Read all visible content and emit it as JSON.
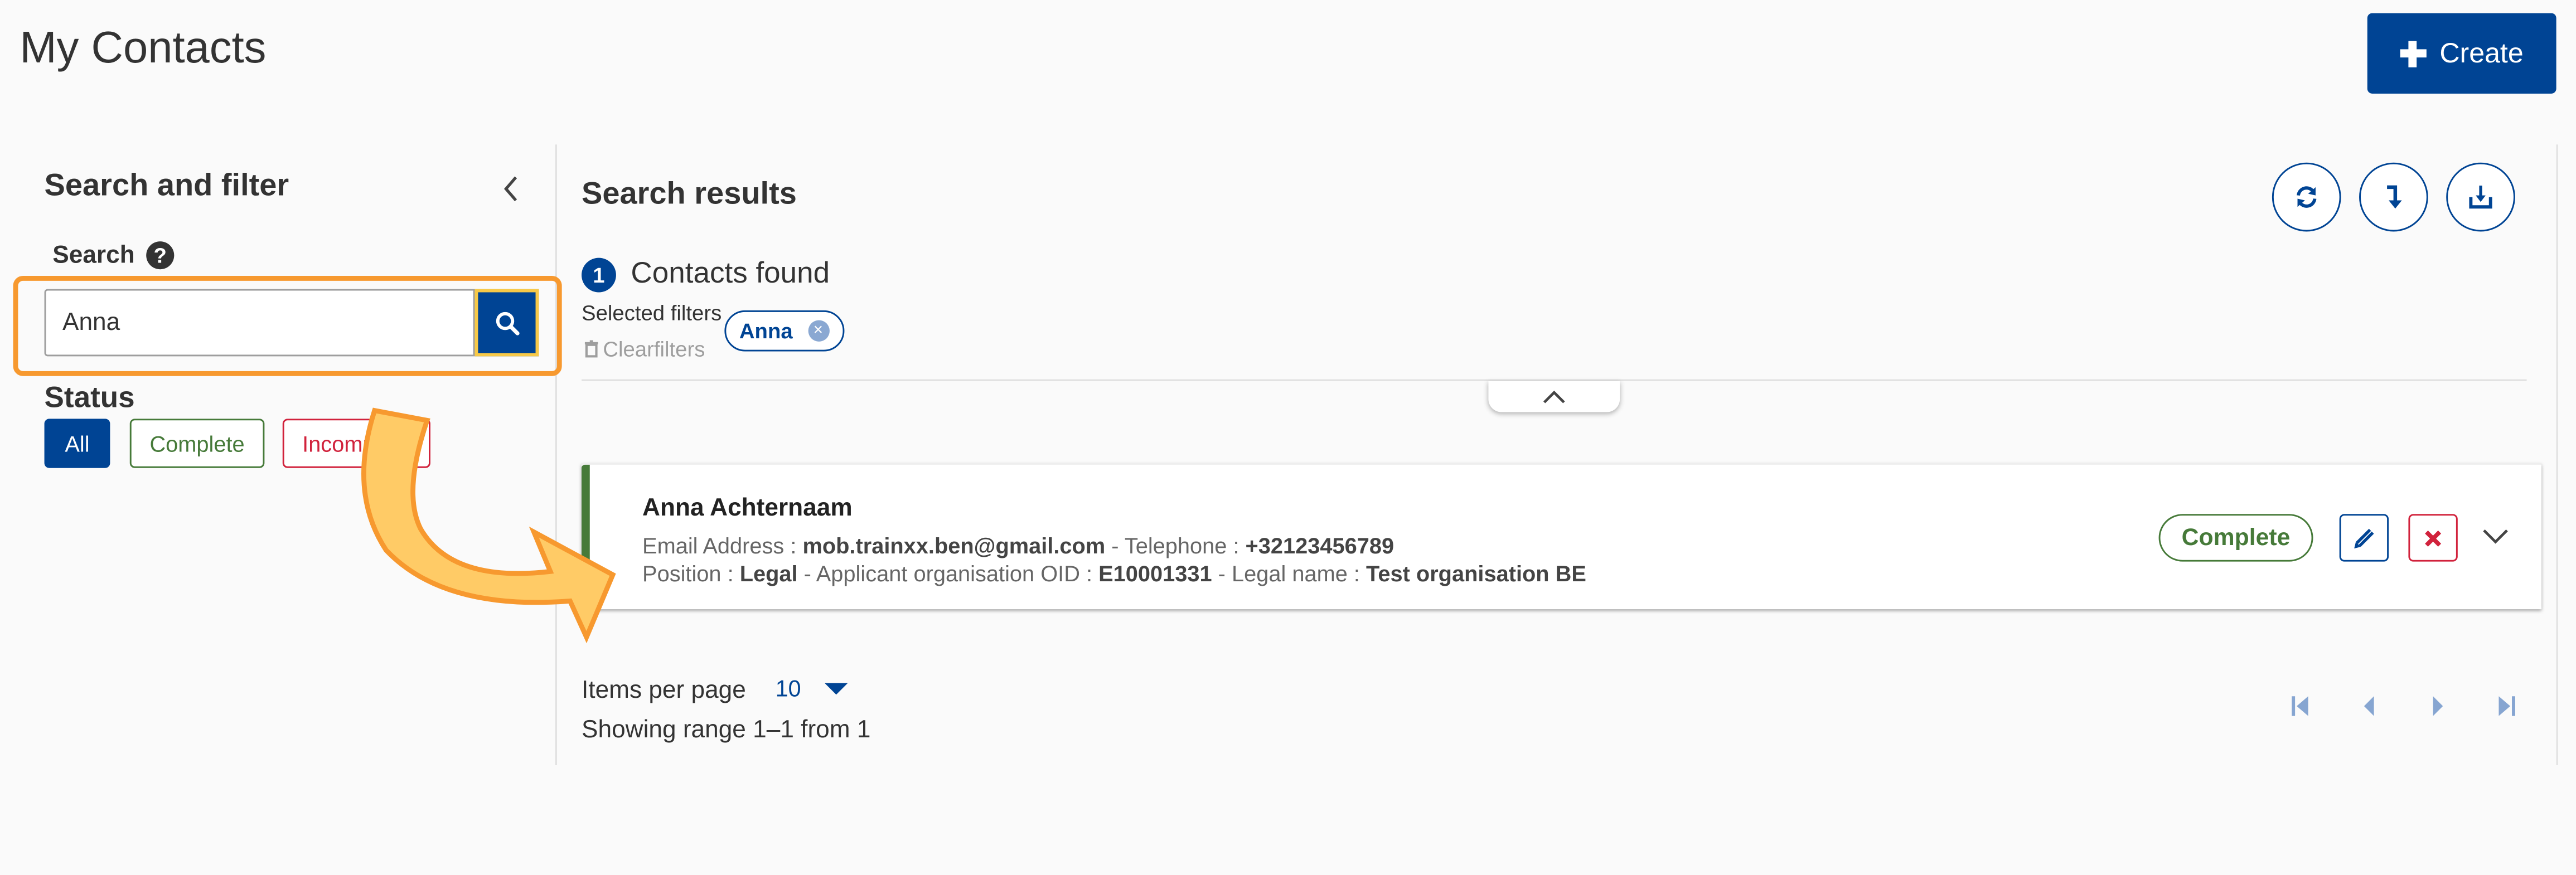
{
  "header": {
    "title": "My Contacts",
    "create_label": "Create"
  },
  "sidebar": {
    "title": "Search and filter",
    "search_label": "Search",
    "help_glyph": "?",
    "search_value": "Anna",
    "status_label": "Status",
    "status_filters": [
      {
        "label": "All",
        "selected": true
      },
      {
        "label": "Complete",
        "selected": false
      },
      {
        "label": "Incomplete",
        "selected": false
      }
    ]
  },
  "results": {
    "title": "Search results",
    "toolbar_icons": [
      "refresh-icon",
      "sort-icon",
      "download-icon"
    ],
    "count": "1",
    "count_label": "Contacts found",
    "selected_filters_label": "Selected filters",
    "filter_chips": [
      {
        "label": "Anna",
        "remove_glyph": "×"
      }
    ],
    "clear_filters_label": "Clearfilters",
    "contacts": [
      {
        "name": "Anna Achternaam",
        "email_label": "Email Address : ",
        "email": "mob.trainxx.ben@gmail.com",
        "telephone_label": " - Telephone : ",
        "telephone": "+32123456789",
        "position_label": "Position : ",
        "position": "Legal",
        "oid_label": " - Applicant organisation OID : ",
        "oid": "E10001331",
        "legal_name_label": " - Legal name : ",
        "legal_name": "Test organisation BE",
        "status": "Complete"
      }
    ]
  },
  "pagination": {
    "items_per_page_label": "Items per page",
    "items_per_page": "10",
    "range_text": "Showing range 1–1 from 1"
  },
  "colors": {
    "primary": "#004494",
    "success": "#467a39",
    "danger": "#d1223c",
    "highlight": "#f7992f",
    "arrow_fill": "#ffcb66",
    "focus_ring": "#f7c948"
  }
}
